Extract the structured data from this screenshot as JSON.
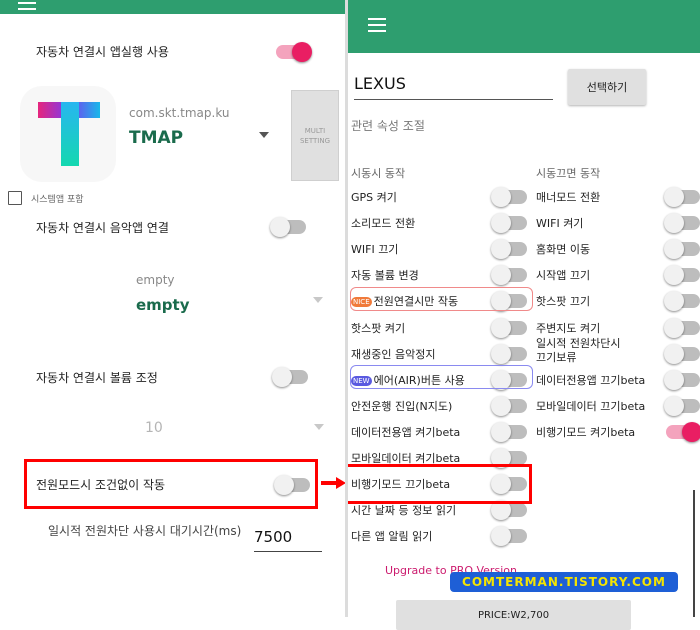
{
  "left": {
    "row_auto_launch": "자동차 연결시 앱실행 사용",
    "app_package": "com.skt.tmap.ku",
    "app_name": "TMAP",
    "multi_setting": "MULTI\nSETTING",
    "include_system": "시스템앱 포함",
    "row_music": "자동차 연결시 음악앱 연결",
    "music_small": "empty",
    "music_big": "empty",
    "row_volume": "자동차 연결시 볼륨 조정",
    "volume_value": "10",
    "row_power_mode": "전원모드시 조건없이 작동",
    "wait_label": "일시적 전원차단 사용시 대기시간(ms)",
    "wait_value": "7500"
  },
  "right": {
    "car_name": "LEXUS",
    "select_button": "선택하기",
    "related_props": "관련 속성 조절",
    "start_header": "시동시 동작",
    "stop_header": "시동끄면 동작",
    "start_items": [
      {
        "label": "GPS 켜기",
        "on": false
      },
      {
        "label": "소리모드 전환",
        "on": false
      },
      {
        "label": "WIFI 끄기",
        "on": false
      },
      {
        "label": "자동 볼륨 변경",
        "on": false
      },
      {
        "label": "전원연결시만 작동",
        "on": false,
        "badge": "NICE"
      },
      {
        "label": "핫스팟 켜기",
        "on": false
      },
      {
        "label": "재생중인 음악정지",
        "on": false
      },
      {
        "label": "에어(AIR)버튼 사용",
        "on": false,
        "badge": "NEW"
      },
      {
        "label": "안전운행 진입(N지도)",
        "on": false
      },
      {
        "label": "데이터전용앱 켜기beta",
        "on": false
      },
      {
        "label": "모바일데이터 켜기beta",
        "on": false
      },
      {
        "label": "비행기모드 끄기beta",
        "on": false
      },
      {
        "label": "시간 날짜 등 정보 읽기",
        "on": false
      },
      {
        "label": "다른 앱 알림 읽기",
        "on": false
      }
    ],
    "stop_items": [
      {
        "label": "매너모드 전환",
        "on": false
      },
      {
        "label": "WIFI 켜기",
        "on": false
      },
      {
        "label": "홈화면 이동",
        "on": false
      },
      {
        "label": "시작앱 끄기",
        "on": false
      },
      {
        "label": "핫스팟 끄기",
        "on": false
      },
      {
        "label": "주변지도 켜기",
        "on": false
      },
      {
        "label": "일시적 전원차단시\n끄기보류",
        "on": false
      },
      {
        "label": "데이터전용앱 끄기beta",
        "on": false
      },
      {
        "label": "모바일데이터 끄기beta",
        "on": false
      },
      {
        "label": "비행기모드 켜기beta",
        "on": true
      }
    ],
    "upgrade": "Upgrade to PRO  Version",
    "watermark": "COMTERMAN.TISTORY.COM",
    "price": "PRICE:W2,700"
  },
  "colors": {
    "toolbar": "#2e9e6f",
    "accent": "#e91e63",
    "highlight": "#ff0000",
    "watermark_bg": "#1e5fd6",
    "watermark_fg": "#f5e400",
    "upgrade": "#cc1b6e"
  }
}
